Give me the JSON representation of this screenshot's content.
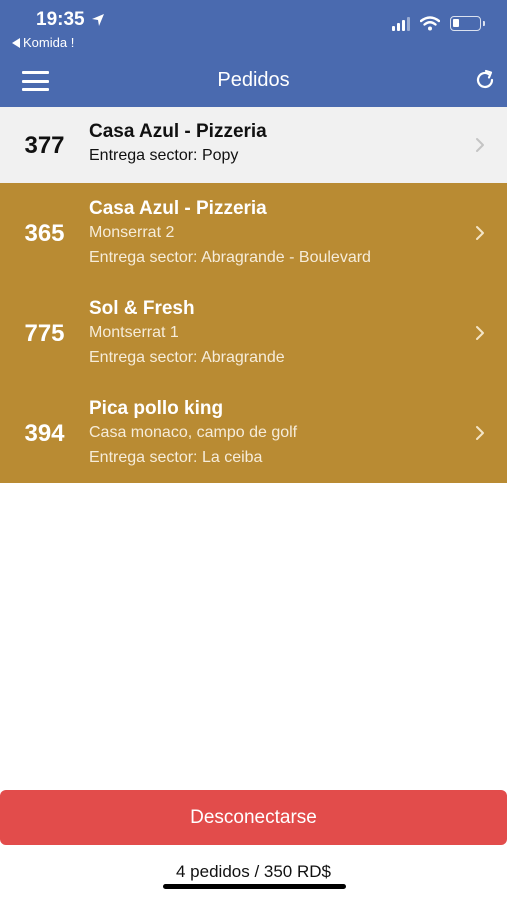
{
  "status_bar": {
    "time": "19:35",
    "back_app": "Komida !",
    "battery_fraction": 0.25
  },
  "nav": {
    "title": "Pedidos",
    "menu_icon": "hamburger-menu-icon",
    "refresh_icon": "refresh-icon"
  },
  "orders": [
    {
      "number": "377",
      "restaurant": "Casa Azul - Pizzeria",
      "address": "",
      "sector": "Entrega sector: Popy"
    },
    {
      "number": "365",
      "restaurant": "Casa Azul - Pizzeria",
      "address": "Monserrat 2",
      "sector": "Entrega sector: Abragrande - Boulevard"
    },
    {
      "number": "775",
      "restaurant": "Sol & Fresh",
      "address": "Montserrat 1",
      "sector": "Entrega sector: Abragrande"
    },
    {
      "number": "394",
      "restaurant": "Pica pollo king",
      "address": "Casa monaco, campo de golf",
      "sector": "Entrega sector: La ceiba"
    }
  ],
  "footer": {
    "logout_label": "Desconectarse",
    "summary": "4 pedidos / 350 RD$"
  },
  "colors": {
    "header": "#4a6aaf",
    "highlight_row": "#b98b33",
    "first_row": "#f1f1f1",
    "logout": "#e24c4b"
  }
}
